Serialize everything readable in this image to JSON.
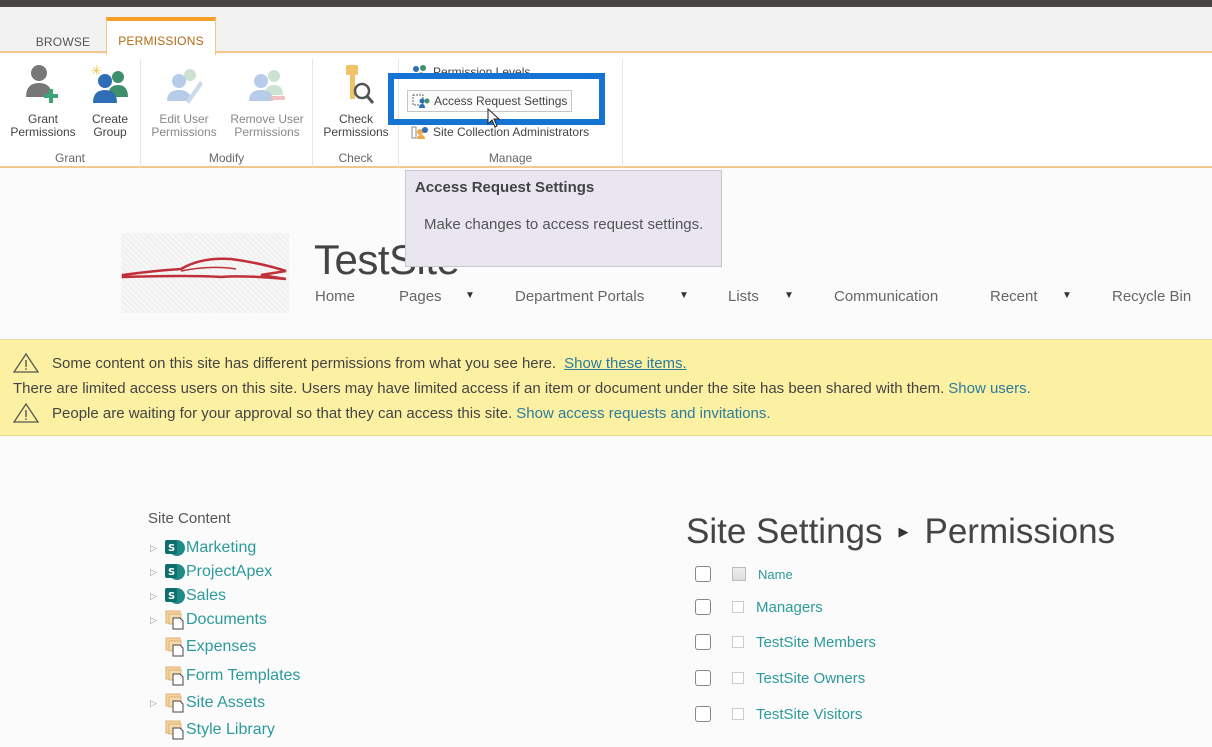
{
  "ribbon": {
    "tabs": [
      {
        "label": "BROWSE",
        "active": false
      },
      {
        "label": "PERMISSIONS",
        "active": true
      }
    ],
    "groups": {
      "grant": {
        "label": "Grant",
        "buttons": [
          {
            "line1": "Grant",
            "line2": "Permissions",
            "icon": "grant-permissions-icon"
          },
          {
            "line1": "Create",
            "line2": "Group",
            "icon": "create-group-icon"
          }
        ]
      },
      "modify": {
        "label": "Modify",
        "buttons": [
          {
            "line1": "Edit User",
            "line2": "Permissions",
            "icon": "edit-user-permissions-icon",
            "disabled": true
          },
          {
            "line1": "Remove User",
            "line2": "Permissions",
            "icon": "remove-user-permissions-icon",
            "disabled": true
          }
        ]
      },
      "check": {
        "label": "Check",
        "buttons": [
          {
            "line1": "Check",
            "line2": "Permissions",
            "icon": "check-permissions-icon"
          }
        ]
      },
      "manage": {
        "label": "Manage",
        "buttons": [
          {
            "label": "Permission Levels",
            "icon": "permission-levels-icon"
          },
          {
            "label": "Access Request Settings",
            "icon": "access-request-settings-icon",
            "hovered": true
          },
          {
            "label": "Site Collection Administrators",
            "icon": "site-collection-administrators-icon"
          }
        ]
      }
    }
  },
  "tooltip": {
    "title": "Access Request Settings",
    "body": "Make changes to access request settings."
  },
  "site": {
    "title": "TestSite",
    "nav": [
      {
        "label": "Home",
        "dropdown": false
      },
      {
        "label": "Pages",
        "dropdown": true
      },
      {
        "label": "Department Portals",
        "dropdown": true
      },
      {
        "label": "Lists",
        "dropdown": true
      },
      {
        "label": "Communication",
        "dropdown": false
      },
      {
        "label": "Recent",
        "dropdown": true
      },
      {
        "label": "Recycle Bin",
        "dropdown": false
      }
    ]
  },
  "banner": {
    "line1": {
      "text": "Some content on this site has different permissions from what you see here.",
      "link": "Show these items."
    },
    "line2": {
      "text": "There are limited access users on this site. Users may have limited access if an item or document under the site has been shared with them.",
      "link": "Show users."
    },
    "line3": {
      "text": "People are waiting for your approval so that they can access this site.",
      "link": "Show access requests and invitations."
    }
  },
  "site_content": {
    "heading": "Site Content",
    "items": [
      {
        "label": "Marketing",
        "type": "site",
        "expandable": true
      },
      {
        "label": "ProjectApex",
        "type": "site",
        "expandable": true
      },
      {
        "label": "Sales",
        "type": "site",
        "expandable": true
      },
      {
        "label": "Documents",
        "type": "library",
        "expandable": true
      },
      {
        "label": "Expenses",
        "type": "library",
        "expandable": false
      },
      {
        "label": "Form Templates",
        "type": "library",
        "expandable": false
      },
      {
        "label": "Site Assets",
        "type": "library",
        "expandable": true
      },
      {
        "label": "Style Library",
        "type": "library",
        "expandable": false
      }
    ]
  },
  "page": {
    "breadcrumb_parent": "Site Settings",
    "breadcrumb_current": "Permissions",
    "column_header": "Name",
    "groups": [
      "Managers",
      "TestSite Members",
      "TestSite Owners",
      "TestSite Visitors"
    ]
  },
  "colors": {
    "accent_orange": "#f7a12a",
    "link_teal": "#2c9a9c",
    "banner_yellow": "#fcf0a2",
    "highlight_blue": "#1573d3",
    "tooltip_bg": "#e9e6f2"
  }
}
